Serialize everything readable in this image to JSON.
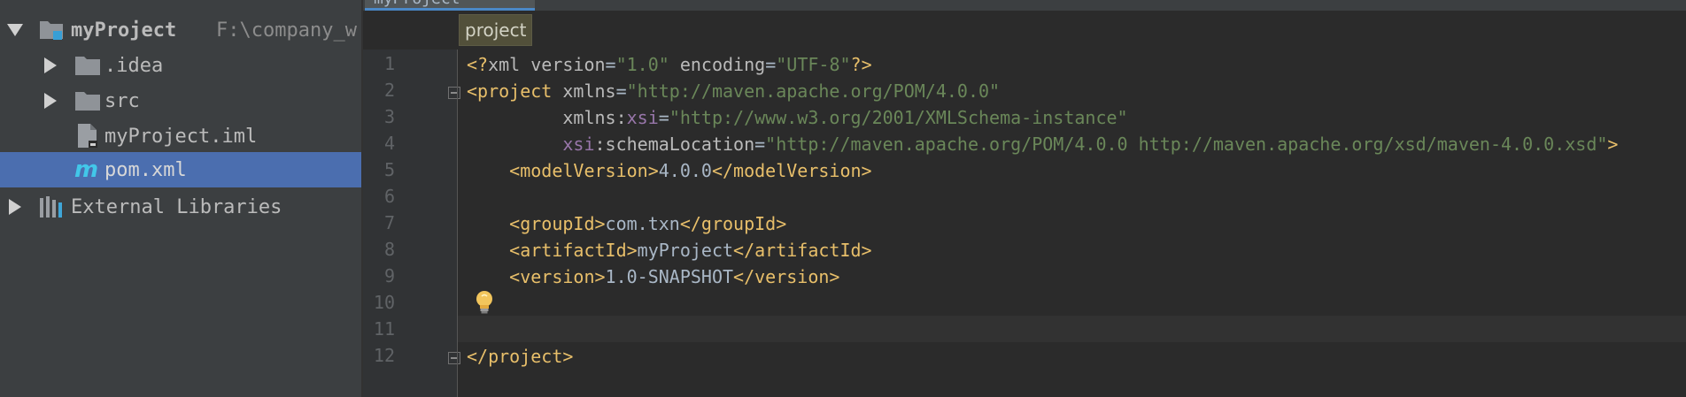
{
  "tree": {
    "root": {
      "name": "myProject",
      "path": "F:\\company_w"
    },
    "items": [
      {
        "label": ".idea"
      },
      {
        "label": "src"
      },
      {
        "label": "myProject.iml"
      },
      {
        "label": "pom.xml"
      }
    ],
    "external": "External Libraries"
  },
  "editor": {
    "tab_label": "myProject",
    "breadcrumb": "project",
    "line_numbers": [
      "1",
      "2",
      "3",
      "4",
      "5",
      "6",
      "7",
      "8",
      "9",
      "10",
      "11",
      "12"
    ],
    "code": {
      "l1": {
        "a": "<?",
        "b": "xml version",
        "c": "=",
        "d": "\"1.0\"",
        "e": " encoding",
        "f": "=",
        "g": "\"UTF-8\"",
        "h": "?>"
      },
      "l2": {
        "a": "<project",
        "b": " xmlns",
        "c": "=",
        "d": "\"http://maven.apache.org/POM/4.0.0\""
      },
      "l3": {
        "indent": "         ",
        "a": "xmlns",
        "b": ":",
        "c": "xsi",
        "d": "=",
        "e": "\"http://www.w3.org/2001/XMLSchema-instance\""
      },
      "l4": {
        "indent": "         ",
        "a": "xsi",
        "b": ":schemaLocation",
        "c": "=",
        "d": "\"http://maven.apache.org/POM/4.0.0 http://maven.apache.org/xsd/maven-4.0.0.xsd\"",
        "e": ">"
      },
      "l5": {
        "indent": "    ",
        "a": "<modelVersion>",
        "b": "4.0.0",
        "c": "</modelVersion>"
      },
      "l7": {
        "indent": "    ",
        "a": "<groupId>",
        "b": "com.txn",
        "c": "</groupId>"
      },
      "l8": {
        "indent": "    ",
        "a": "<artifactId>",
        "b": "myProject",
        "c": "</artifactId>"
      },
      "l9": {
        "indent": "    ",
        "a": "<version>",
        "b": "1.0-SNAPSHOT",
        "c": "</version>"
      },
      "l12": {
        "a": "</project>"
      }
    }
  },
  "colors": {
    "tree_bg": "#3c3f41",
    "selection": "#4b6eaf",
    "editor_bg": "#2b2b2b",
    "tag": "#e8bf6a",
    "string": "#6a8759",
    "namespace": "#9876aa"
  },
  "icons": [
    "folder-icon",
    "module-folder-icon",
    "iml-file-icon",
    "maven-file-icon",
    "libraries-icon",
    "lightbulb-icon",
    "fold-icon"
  ]
}
